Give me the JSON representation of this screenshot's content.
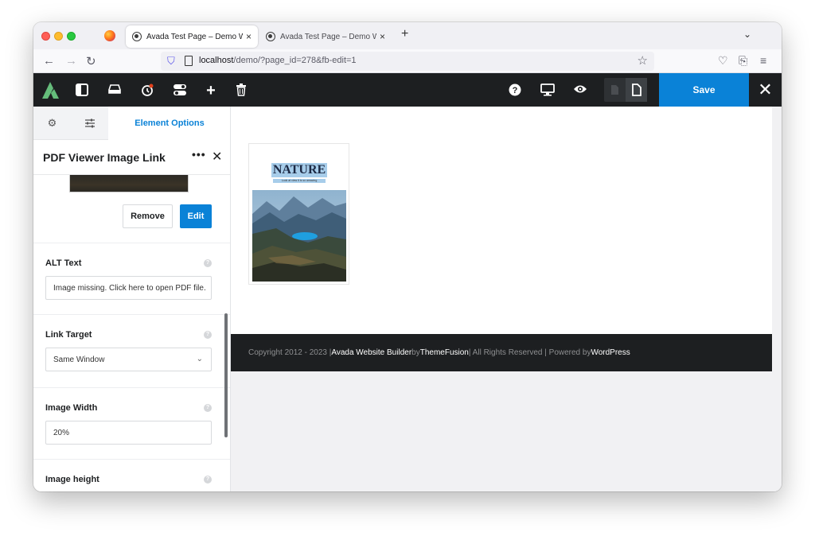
{
  "browser": {
    "tabs": [
      {
        "title": "Avada Test Page – Demo Websi",
        "active": true
      },
      {
        "title": "Avada Test Page – Demo Websi",
        "active": false
      }
    ],
    "new_tab_label": "+",
    "tabs_menu": "⌄",
    "url_host": "localhost",
    "url_path": "/demo/?page_id=278&fb-edit=1"
  },
  "toolbar": {
    "save_label": "Save",
    "close_label": "✕",
    "icons": [
      "avada-logo-icon",
      "sidebar-toggle-icon",
      "library-icon",
      "history-icon",
      "toggle-icon",
      "add-icon",
      "trash-icon",
      "help-icon",
      "desktop-icon",
      "preview-icon"
    ]
  },
  "sidebar": {
    "tabs": {
      "settings_icon": "⚙",
      "sliders_icon": "☰",
      "element_options": "Element Options"
    },
    "panel_title": "PDF Viewer Image Link",
    "more_label": "•••",
    "close_label": "✕",
    "remove_label": "Remove",
    "edit_label": "Edit",
    "fields": [
      {
        "label": "ALT Text",
        "value": "Image missing. Click here to open PDF file."
      },
      {
        "label": "Link Target",
        "value": "Same Window"
      },
      {
        "label": "Image Width",
        "value": "20%"
      },
      {
        "label": "Image height",
        "value": ""
      }
    ]
  },
  "preview": {
    "title": "NATURE",
    "subtitle": "Look at view it is so amazing"
  },
  "footer": {
    "copyright": "Copyright 2012 - 2023 | ",
    "builder": "Avada Website Builder",
    "by": " by ",
    "company": "ThemeFusion",
    "rights": " | All Rights Reserved | Powered by ",
    "platform": "WordPress"
  },
  "colors": {
    "accent": "#0a82d7",
    "toolbar_bg": "#1d1f21",
    "avada_green": "#65bc7b"
  }
}
